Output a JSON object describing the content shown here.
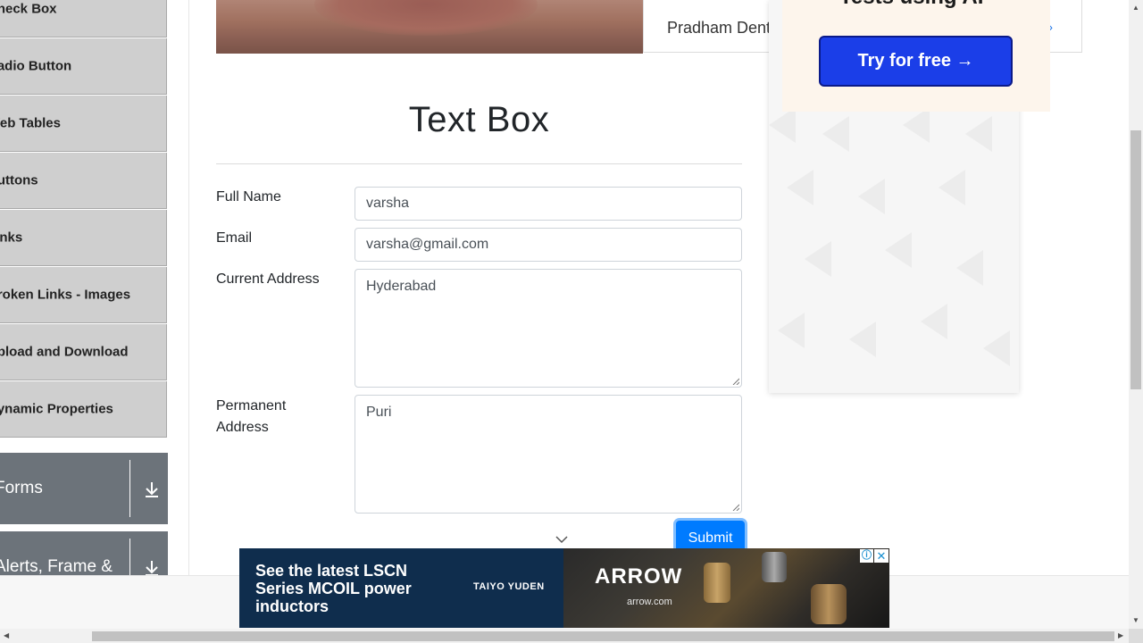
{
  "sidebar": {
    "items": [
      {
        "label": "Check Box"
      },
      {
        "label": "Radio Button"
      },
      {
        "label": "Web Tables"
      },
      {
        "label": "Buttons"
      },
      {
        "label": "Links"
      },
      {
        "label": "Broken Links - Images"
      },
      {
        "label": "Upload and Download"
      },
      {
        "label": "Dynamic Properties"
      }
    ],
    "groups": [
      {
        "label": "Forms",
        "icon": "download-icon"
      },
      {
        "label": "Alerts, Frame &",
        "icon": "download-icon"
      }
    ]
  },
  "hero": {
    "card_text": "Pradham Dent",
    "arrow": "›"
  },
  "form": {
    "title": "Text Box",
    "full_name_label": "Full Name",
    "full_name_value": "varsha",
    "email_label": "Email",
    "email_value": "varsha@gmail.com",
    "current_address_label": "Current Address",
    "current_address_value": "Hyderabad",
    "permanent_address_label_line1": "Permanent",
    "permanent_address_label_line2": "Address",
    "permanent_address_value": "Puri",
    "submit_label": "Submit"
  },
  "ad_right": {
    "headline": "Tests using AI",
    "button_label": "Try for free →"
  },
  "ad_bottom": {
    "text": "See the latest LSCN Series MCOIL power inductors",
    "brand": "TAIYO YUDEN",
    "logo": "ARROW",
    "url": "arrow.com",
    "adchoices": "ⓘ",
    "close": "✕"
  },
  "colors": {
    "submit": "#007bff",
    "sidebar_item": "#cfcfcf",
    "group_header": "#6c737a",
    "try_button": "#1b3ee8"
  }
}
